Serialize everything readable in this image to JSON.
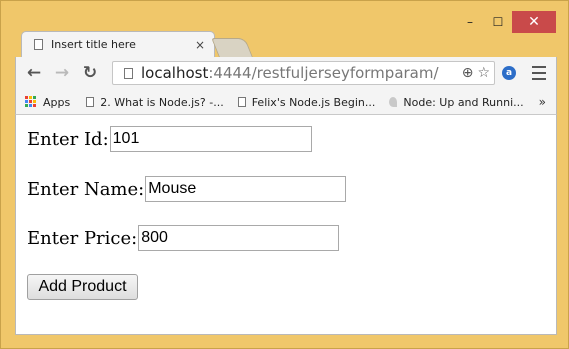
{
  "window": {
    "controls": {
      "minimize": "–",
      "maximize": "☐",
      "close": "✕"
    }
  },
  "tab": {
    "title": "Insert title here",
    "close_label": "×"
  },
  "toolbar": {
    "url_host": "localhost",
    "url_rest": ":4444/restfuljerseyformparam/"
  },
  "bookmarks": {
    "apps_label": "Apps",
    "items": [
      "2. What is Node.js? -...",
      "Felix's Node.js Begin...",
      "Node: Up and Runni..."
    ],
    "overflow": "»"
  },
  "form": {
    "id_label": "Enter Id:",
    "id_value": "101",
    "name_label": "Enter Name:",
    "name_value": "Mouse",
    "price_label": "Enter Price:",
    "price_value": "800",
    "submit_label": "Add Product"
  },
  "colors": {
    "window_frame": "#f0c76a",
    "close_button": "#c94a4a",
    "browser_chrome": "#f4f4f4"
  }
}
